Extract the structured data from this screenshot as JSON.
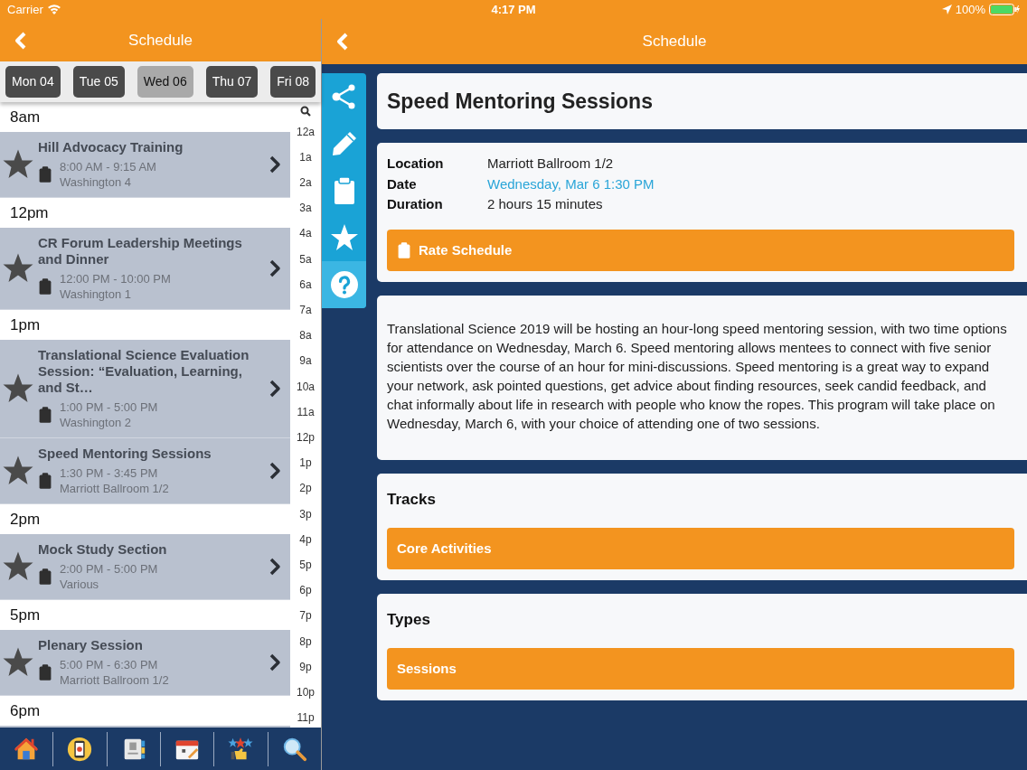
{
  "status_bar": {
    "carrier": "Carrier",
    "time": "4:17 PM",
    "battery": "100%"
  },
  "left_nav": {
    "title": "Schedule"
  },
  "days": [
    {
      "label": "Mon 04",
      "selected": false
    },
    {
      "label": "Tue 05",
      "selected": false
    },
    {
      "label": "Wed 06",
      "selected": true
    },
    {
      "label": "Thu 07",
      "selected": false
    },
    {
      "label": "Fri 08",
      "selected": false
    }
  ],
  "schedule": [
    {
      "kind": "header",
      "label": "8am"
    },
    {
      "kind": "event",
      "title": "Hill Advocacy Training",
      "time": "8:00 AM - 9:15 AM",
      "location": "Washington 4"
    },
    {
      "kind": "header",
      "label": "12pm"
    },
    {
      "kind": "event",
      "title": "CR Forum Leadership Meetings and Dinner",
      "time": "12:00 PM - 10:00 PM",
      "location": "Washington 1"
    },
    {
      "kind": "header",
      "label": "1pm"
    },
    {
      "kind": "event",
      "title": "Translational Science Evaluation Session: “Evaluation, Learning, and St…",
      "time": "1:00 PM - 5:00 PM",
      "location": "Washington 2"
    },
    {
      "kind": "event",
      "title": "Speed Mentoring Sessions",
      "time": "1:30 PM - 3:45 PM",
      "location": "Marriott Ballroom 1/2"
    },
    {
      "kind": "header",
      "label": "2pm"
    },
    {
      "kind": "event",
      "title": "Mock Study Section",
      "time": "2:00 PM - 5:00 PM",
      "location": "Various"
    },
    {
      "kind": "header",
      "label": "5pm"
    },
    {
      "kind": "event",
      "title": "Plenary Session",
      "time": "5:00 PM - 6:30 PM",
      "location": "Marriott Ballroom 1/2"
    },
    {
      "kind": "header",
      "label": "6pm"
    }
  ],
  "index": [
    "12a",
    "1a",
    "2a",
    "3a",
    "4a",
    "5a",
    "6a",
    "7a",
    "8a",
    "9a",
    "10a",
    "11a",
    "12p",
    "1p",
    "2p",
    "3p",
    "4p",
    "5p",
    "6p",
    "7p",
    "8p",
    "9p",
    "10p",
    "11p"
  ],
  "right_nav": {
    "title": "Schedule"
  },
  "tools": [
    {
      "kind": "share",
      "selected": false
    },
    {
      "kind": "pencil",
      "selected": false
    },
    {
      "kind": "clipboard",
      "selected": false
    },
    {
      "kind": "star",
      "selected": false
    },
    {
      "kind": "help",
      "selected": true
    }
  ],
  "detail": {
    "title": "Speed Mentoring Sessions",
    "fields": [
      {
        "label": "Location",
        "value": "Marriott Ballroom 1/2",
        "kind": "text"
      },
      {
        "label": "Date",
        "value": "Wednesday, Mar 6 1:30 PM",
        "kind": "link"
      },
      {
        "label": "Duration",
        "value": "2 hours 15 minutes",
        "kind": "text"
      }
    ],
    "rate_button": "Rate Schedule",
    "description": "Translational Science 2019 will be hosting an hour-long speed mentoring session, with two time options for attendance on Wednesday, March 6. Speed mentoring allows mentees to connect with five senior scientists over the course of an hour for mini-discussions. Speed mentoring is a great way to expand your network, ask pointed questions, get advice about finding resources, seek candid feedback, and chat informally about life in research with people who know the ropes. This program will take place on Wednesday, March 6, with your choice of attending one of two sessions.",
    "sections": [
      {
        "heading": "Tracks",
        "items": [
          "Core Activities"
        ]
      },
      {
        "heading": "Types",
        "items": [
          "Sessions"
        ]
      }
    ]
  }
}
